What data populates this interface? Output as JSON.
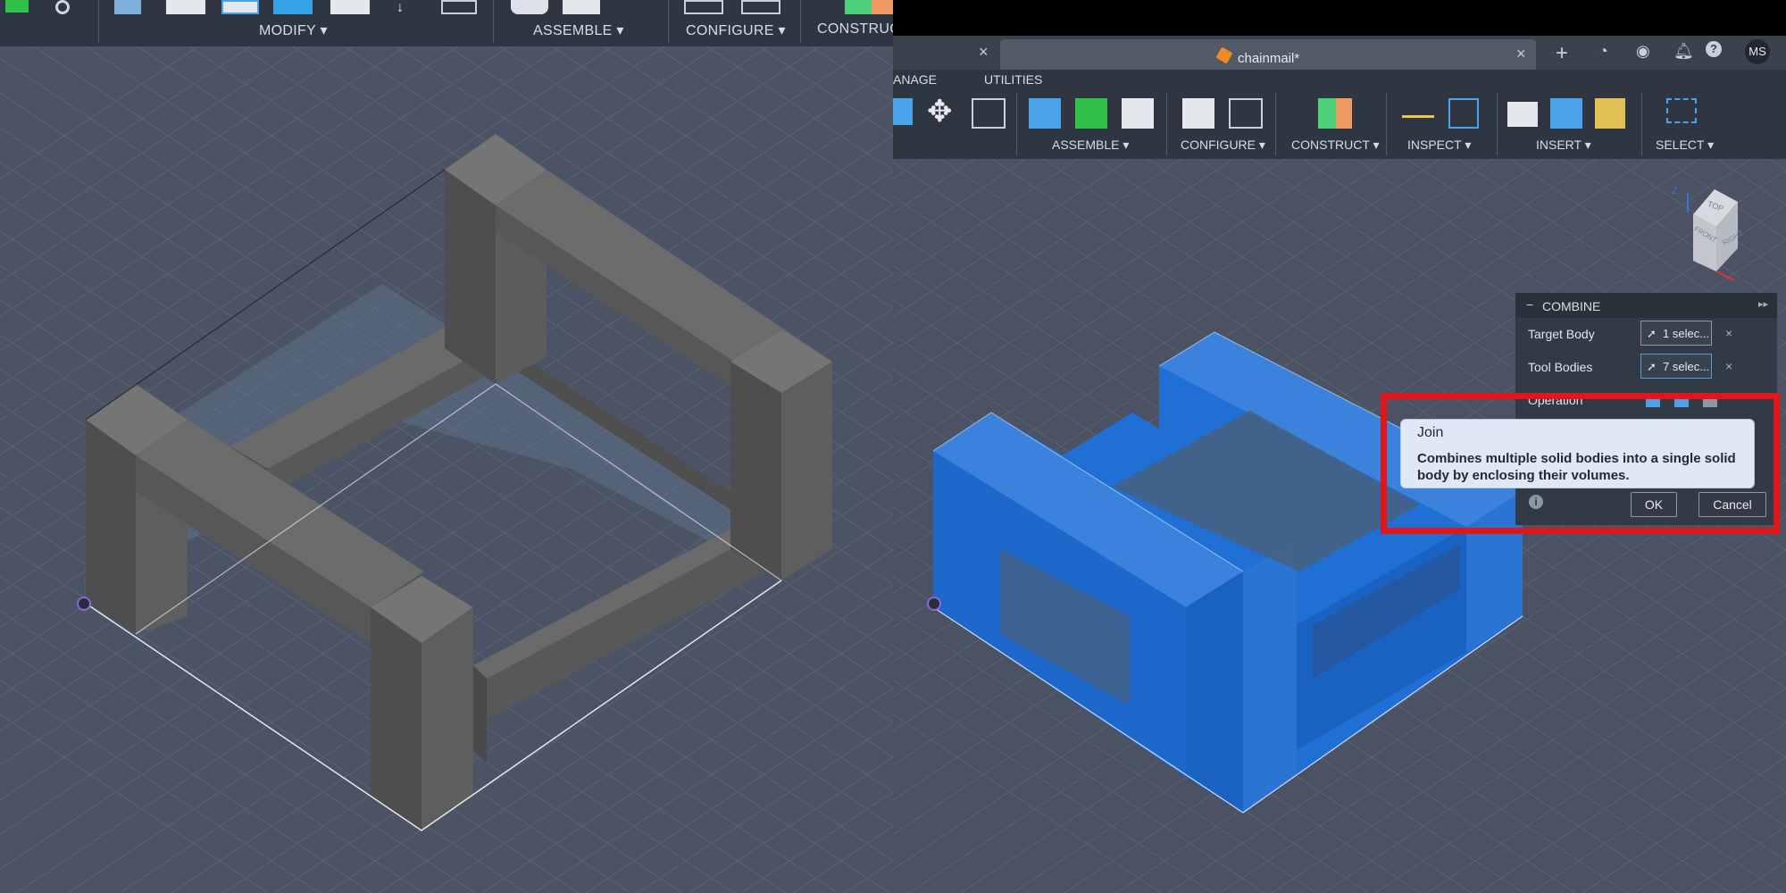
{
  "left_toolbar": {
    "groups": [
      "MODIFY",
      "ASSEMBLE",
      "CONFIGURE",
      "CONSTRUCT"
    ]
  },
  "right_app": {
    "tab": {
      "title": "chainmail*"
    },
    "account": {
      "initials": "MS"
    },
    "menu_partial": "ANAGE",
    "menu": [
      "UTILITIES"
    ],
    "toolbar_groups": [
      "ASSEMBLE",
      "CONFIGURE",
      "CONSTRUCT",
      "INSPECT",
      "INSERT",
      "SELECT"
    ],
    "viewcube": {
      "top": "TOP",
      "front": "FRONT",
      "right": "RIGHT",
      "axis_z": "Z"
    },
    "combine": {
      "title": "COMBINE",
      "target_label": "Target Body",
      "target_value": "1 selec...",
      "tool_label": "Tool Bodies",
      "tool_value": "7 selec...",
      "operation_label": "Operation",
      "tooltip_title": "Join",
      "tooltip_body": "Combines multiple solid bodies into a single solid body by enclosing their volumes.",
      "ok": "OK",
      "cancel": "Cancel"
    }
  },
  "colors": {
    "accent_blue": "#1f6fd4",
    "highlight_red": "#e0161b",
    "gray_body": "#5e5e5e"
  }
}
